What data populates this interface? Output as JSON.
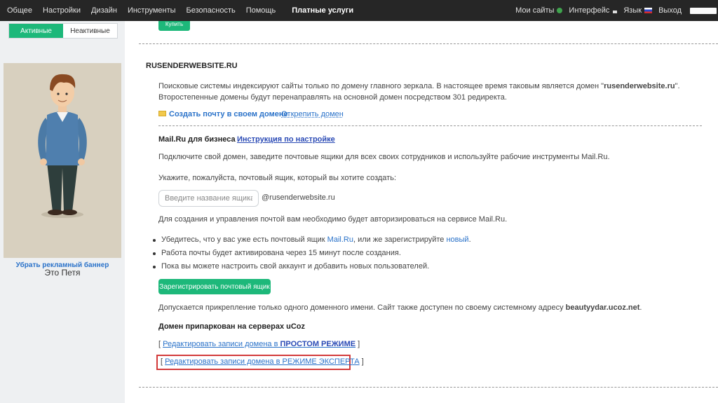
{
  "topnav": {
    "left": [
      "Общее",
      "Настройки",
      "Дизайн",
      "Инструменты",
      "Безопасность",
      "Помощь"
    ],
    "active": "Платные услуги",
    "my_sites": "Мои сайты",
    "interface": "Интерфейс",
    "language": "Язык",
    "logout": "Выход"
  },
  "sidebar": {
    "tab_active": "Активные",
    "tab_inactive": "Неактивные",
    "banner_caption": "Это Петя",
    "remove_banner": "Убрать рекламный баннер"
  },
  "main": {
    "buy_label": "Купить",
    "domain_title": "RUSENDERWEBSITE.RU",
    "mirror_text_1": "Поисковые системы индексируют сайты только по домену главного зеркала. В настоящее время таковым является домен \"",
    "mirror_domain": "rusenderwebsite.ru",
    "mirror_text_1_end": "\".",
    "mirror_text_2": "Второстепенные домены будут перенаправлять на основной домен посредством 301 редиректа.",
    "create_mail_link": "Создать почту в своем домене",
    "unpin_domain_link": "Открепить домен",
    "mailru_title": "Mail.Ru для бизнеса",
    "mailru_instruction": "Инструкция по настройке",
    "connect_text": "Подключите свой домен, заведите почтовые ящики для всех своих сотрудников и используйте рабочие инструменты Mail.Ru.",
    "specify_text": "Укажите, пожалуйста, почтовый ящик, который вы хотите создать:",
    "mailbox_placeholder": "Введите название ящика",
    "domain_suffix": "@rusenderwebsite.ru",
    "auth_text": "Для создания и управления почтой вам необходимо будет авторизироваться на сервисе Mail.Ru.",
    "bullet_1_pre": "Убедитесь, что у вас уже есть почтовый ящик ",
    "bullet_1_link1": "Mail.Ru",
    "bullet_1_mid": ", или же зарегистрируйте ",
    "bullet_1_link2": "новый",
    "bullet_1_end": ".",
    "bullet_2": "Работа почты будет активирована через 15 минут после создания.",
    "bullet_3": "Пока вы можете настроить свой аккаунт и добавить новых пользователей.",
    "register_button": "Зарегистрировать почтовый ящик",
    "one_domain_text": "Допускается прикрепление только одного доменного имени. Сайт также доступен по своему системному адресу ",
    "system_address": "beautyydar.ucoz.net",
    "one_domain_end": ".",
    "parked_title": "Домен припаркован на серверах uCoz",
    "edit_simple_pre": "Редактировать записи домена в ",
    "edit_simple_mode": "ПРОСТОМ РЕЖИМЕ",
    "edit_expert": "Редактировать записи домена в РЕЖИМЕ ЭКСПЕРТА",
    "bracket_open": "[ ",
    "bracket_close": " ]"
  }
}
